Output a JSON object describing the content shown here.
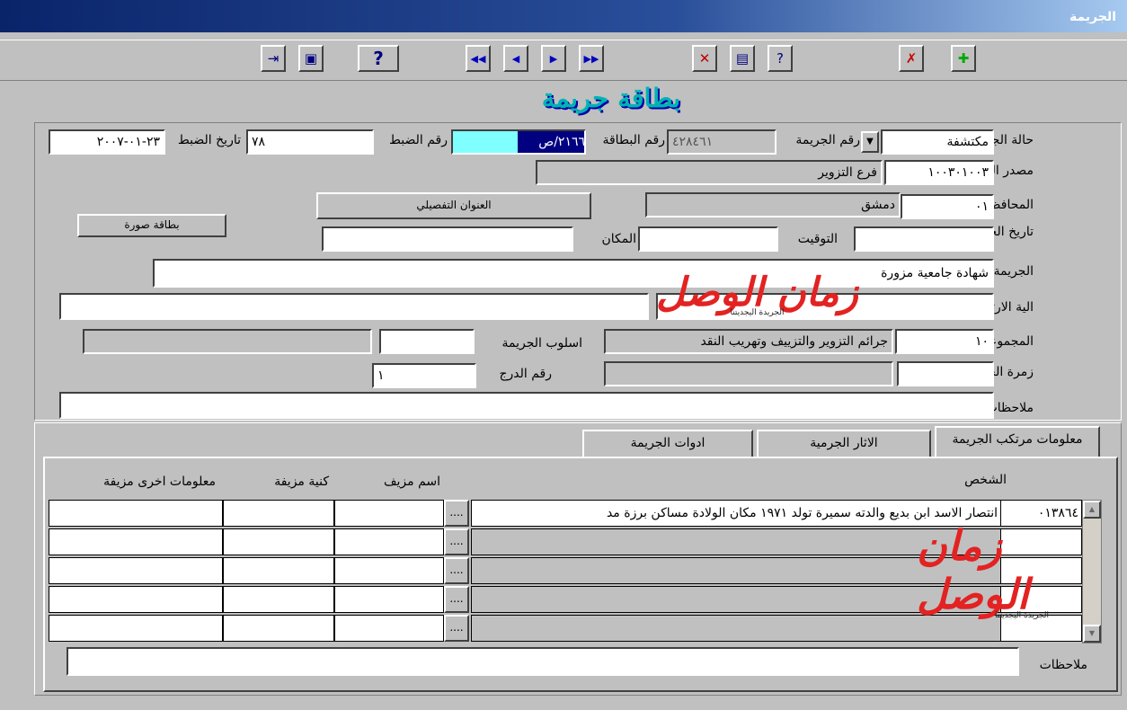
{
  "window": {
    "title": "الجريمة"
  },
  "toolbar": {
    "buttons": [
      {
        "name": "exit-icon",
        "glyph": "⇥"
      },
      {
        "name": "save-icon",
        "glyph": "▣"
      },
      {
        "name": "help-icon",
        "glyph": "?"
      },
      {
        "name": "first-record-icon",
        "glyph": "◀◀"
      },
      {
        "name": "prev-record-icon",
        "glyph": "◀"
      },
      {
        "name": "next-record-icon",
        "glyph": "▶"
      },
      {
        "name": "last-record-icon",
        "glyph": "▶▶"
      },
      {
        "name": "delete-query-icon",
        "glyph": "✕"
      },
      {
        "name": "execute-query-icon",
        "glyph": "▤"
      },
      {
        "name": "enter-query-icon",
        "glyph": "?"
      },
      {
        "name": "delete-record-icon",
        "glyph": "✗"
      },
      {
        "name": "insert-record-icon",
        "glyph": "✚"
      }
    ]
  },
  "header": {
    "title": "بطاقة جريمة"
  },
  "form": {
    "crime_status_label": "حالة الجريمة",
    "crime_status_value": "مكتشفة",
    "crime_number_label": "رقم الجريمة",
    "crime_number_value": "٤٢٨٤٦١",
    "card_number_label": "رقم البطاقة",
    "card_number_value": "٢١٦٦/ص",
    "seizure_number_label": "رقم الضبط",
    "seizure_number_value": "٧٨",
    "seizure_date_label": "تاريخ الضبط",
    "seizure_date_value": "٢٣-٠١-٢٠٠٧",
    "seizure_source_label": "مصدر الضبط",
    "seizure_source_code": "١٠٠٣٠١٠٠٣",
    "seizure_source_name": "فرع التزوير",
    "governorate_label": "المحافظة",
    "governorate_code": "٠١",
    "governorate_name": "دمشق",
    "detailed_address_button": "العنوان التفصيلي",
    "photo_card_button": "بطاقة صورة",
    "crime_date_label": "تاريخ الجريمة",
    "time_label": "التوقيت",
    "place_label": "المكان",
    "crime_results_label": "الجريمة ونتائجها",
    "crime_results_value": "شهادة جامعية مزورة",
    "method_label": "الية الارتكاب",
    "criminal_group_label": "المجموعة الجرمية",
    "criminal_group_code": "١٠",
    "criminal_group_name": "جرائم التزوير والتزييف وتهريب النقد",
    "crime_style_label": "اسلوب الجريمة",
    "crime_category_label": "زمرة الجريمة",
    "drawer_number_label": "رقم الدرج",
    "drawer_number_value": "١",
    "notes_label": "ملاحظات"
  },
  "tabs": [
    {
      "label": "معلومات مرتكب الجريمة",
      "active": true
    },
    {
      "label": "الاثار الجرمية",
      "active": false
    },
    {
      "label": "ادوات الجريمة",
      "active": false
    }
  ],
  "grid": {
    "headers": {
      "person": "الشخص",
      "fake_name": "اسم مزيف",
      "fake_nickname": "كنية مزيفة",
      "other_fake_info": "معلومات اخرى مزيفة"
    },
    "rows": [
      {
        "code": "٠١٣٨٦٤",
        "person": "انتصار  الاسد ابن بديع والدته سميرة تولد  ١٩٧١ مكان الولادة  مساكن برزة مد",
        "dots": "...."
      },
      {
        "code": "",
        "person": "",
        "dots": "...."
      },
      {
        "code": "",
        "person": "",
        "dots": "...."
      },
      {
        "code": "",
        "person": "",
        "dots": "...."
      },
      {
        "code": "",
        "person": "",
        "dots": "...."
      }
    ],
    "notes_label": "ملاحظات"
  },
  "watermark": {
    "text": "زمان الوصل",
    "subtext": "الجريدة اليجديتنا"
  }
}
